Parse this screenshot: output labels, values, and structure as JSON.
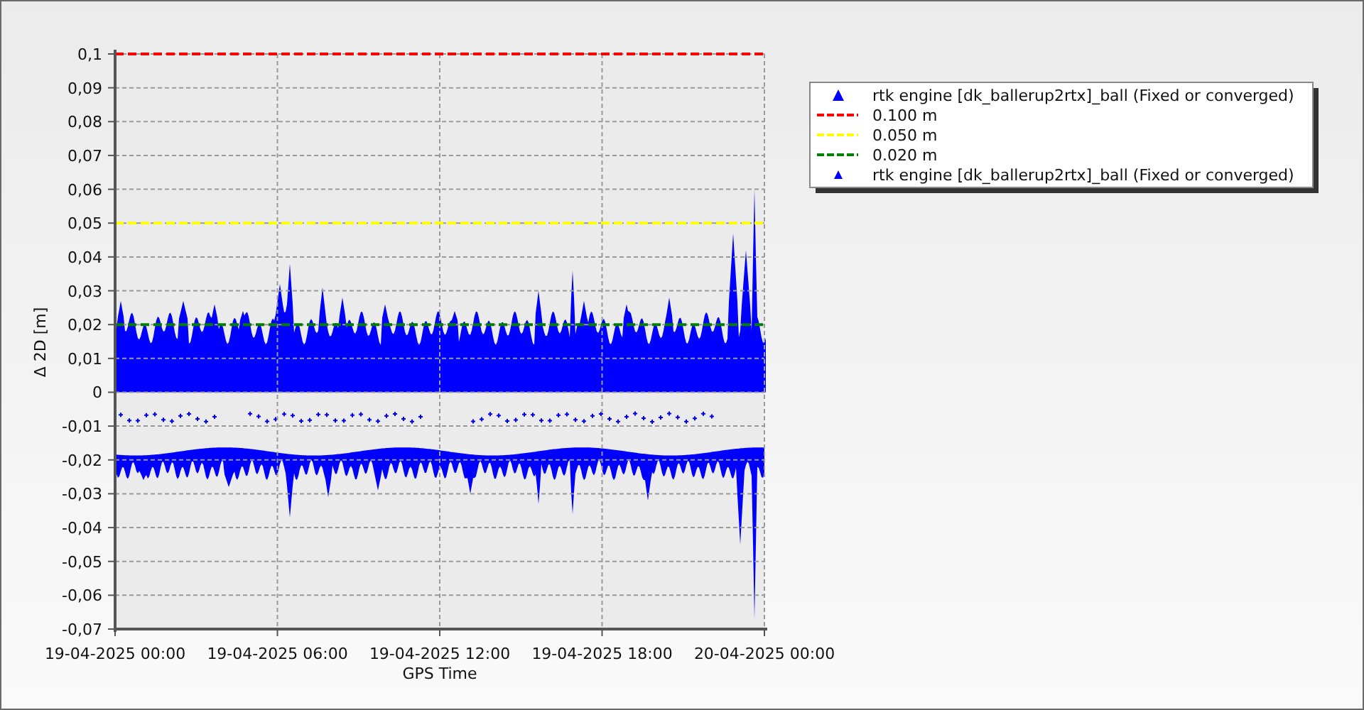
{
  "chart": {
    "legend": [
      {
        "kind": "large_marker",
        "color": "#0000ff",
        "label": "rtk engine [dk_ballerup2rtx]_ball (Fixed or converged)"
      },
      {
        "kind": "series"
      },
      {
        "kind": "series"
      },
      {
        "kind": "series"
      },
      {
        "kind": "small_marker",
        "color": "#0000ff",
        "label": "rtk engine [dk_ballerup2rtx]_ball (Fixed or converged)"
      }
    ],
    "chart_data": {
      "type": "line",
      "xlabel": "GPS Time",
      "ylabel": "Δ 2D [m]",
      "grid": true,
      "legend": true,
      "categories": [
        "19-04-2025 00:00",
        "19-04-2025 06:00",
        "19-04-2025 12:00",
        "19-04-2025 18:00",
        "20-04-2025 00:00"
      ],
      "ylim": [
        -0.07,
        0.1
      ],
      "yticks": [
        {
          "value": 0.1,
          "label": "0,1"
        },
        {
          "value": 0.09,
          "label": "0,09"
        },
        {
          "value": 0.08,
          "label": "0,08"
        },
        {
          "value": 0.07,
          "label": "0,07"
        },
        {
          "value": 0.06,
          "label": "0,06"
        },
        {
          "value": 0.05,
          "label": "0,05"
        },
        {
          "value": 0.04,
          "label": "0,04"
        },
        {
          "value": 0.03,
          "label": "0,03"
        },
        {
          "value": 0.02,
          "label": "0,02"
        },
        {
          "value": 0.01,
          "label": "0,01"
        },
        {
          "value": 0,
          "label": "0"
        },
        {
          "value": -0.01,
          "label": "-0,01"
        },
        {
          "value": -0.02,
          "label": "-0,02"
        },
        {
          "value": -0.03,
          "label": "-0,03"
        },
        {
          "value": -0.04,
          "label": "-0,04"
        },
        {
          "value": -0.05,
          "label": "-0,05"
        },
        {
          "value": -0.06,
          "label": "-0,06"
        },
        {
          "value": -0.07,
          "label": "-0,07"
        }
      ],
      "series": [
        {
          "name": "0.100 m",
          "color": "#ff0000",
          "line_style": "dashed",
          "values": [
            0.1,
            0.1,
            0.1,
            0.1,
            0.1
          ]
        },
        {
          "name": "0.050 m",
          "color": "#ffff00",
          "line_style": "dashed",
          "values": [
            0.05,
            0.05,
            0.05,
            0.05,
            0.05
          ]
        },
        {
          "name": "0.020 m",
          "color": "#008000",
          "line_style": "dashed",
          "values": [
            0.02,
            0.02,
            0.02,
            0.02,
            0.02
          ]
        }
      ]
    }
  }
}
